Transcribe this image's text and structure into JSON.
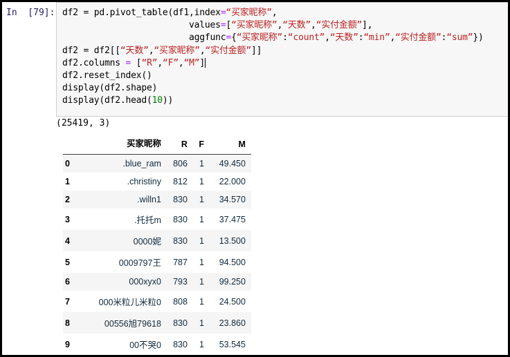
{
  "notebook": {
    "cell": {
      "prompt_label": "In  [79]:",
      "code_lines": [
        [
          {
            "t": "df2 = pd.pivot_table(df1,index",
            "c": "plain"
          },
          {
            "t": "=",
            "c": "op"
          },
          {
            "t": "“买家昵称”",
            "c": "str"
          },
          {
            "t": ",",
            "c": "plain"
          }
        ],
        [
          {
            "t": "                        values",
            "c": "plain"
          },
          {
            "t": "=",
            "c": "op"
          },
          {
            "t": "[",
            "c": "plain"
          },
          {
            "t": "“买家昵称”",
            "c": "str"
          },
          {
            "t": ",",
            "c": "plain"
          },
          {
            "t": "“天数”",
            "c": "str"
          },
          {
            "t": ",",
            "c": "plain"
          },
          {
            "t": "“实付金额”",
            "c": "str"
          },
          {
            "t": "],",
            "c": "plain"
          }
        ],
        [
          {
            "t": "                        aggfunc",
            "c": "plain"
          },
          {
            "t": "=",
            "c": "op"
          },
          {
            "t": "{",
            "c": "plain"
          },
          {
            "t": "“买家昵称”",
            "c": "str"
          },
          {
            "t": ":",
            "c": "plain"
          },
          {
            "t": "“count”",
            "c": "str"
          },
          {
            "t": ",",
            "c": "plain"
          },
          {
            "t": "“天数”",
            "c": "str"
          },
          {
            "t": ":",
            "c": "plain"
          },
          {
            "t": "“min”",
            "c": "str"
          },
          {
            "t": ",",
            "c": "plain"
          },
          {
            "t": "“实付金额”",
            "c": "str"
          },
          {
            "t": ":",
            "c": "plain"
          },
          {
            "t": "“sum”",
            "c": "str"
          },
          {
            "t": "})",
            "c": "plain"
          }
        ],
        [
          {
            "t": "df2 = df2[[",
            "c": "plain"
          },
          {
            "t": "“天数”",
            "c": "str"
          },
          {
            "t": ",",
            "c": "plain"
          },
          {
            "t": "“买家昵称”",
            "c": "str"
          },
          {
            "t": ",",
            "c": "plain"
          },
          {
            "t": "“实付金额”",
            "c": "str"
          },
          {
            "t": "]]",
            "c": "plain"
          }
        ],
        [
          {
            "t": "df2.columns ",
            "c": "plain"
          },
          {
            "t": "=",
            "c": "op"
          },
          {
            "t": " [",
            "c": "plain"
          },
          {
            "t": "“R”",
            "c": "str"
          },
          {
            "t": ",",
            "c": "plain"
          },
          {
            "t": "“F”",
            "c": "str"
          },
          {
            "t": ",",
            "c": "plain"
          },
          {
            "t": "“M”",
            "c": "str"
          },
          {
            "t": "]",
            "c": "plain"
          },
          {
            "t": "",
            "c": "caret"
          }
        ],
        [
          {
            "t": "df2.reset_index()",
            "c": "plain"
          }
        ],
        [
          {
            "t": "display(df2.shape)",
            "c": "plain"
          }
        ],
        [
          {
            "t": "display(df2.head(",
            "c": "plain"
          },
          {
            "t": "10",
            "c": "num"
          },
          {
            "t": "))",
            "c": "plain"
          }
        ]
      ]
    },
    "output_shape": "(25419, 3)",
    "dataframe": {
      "index_header": "",
      "columns": [
        "买家昵称",
        "R",
        "F",
        "M"
      ],
      "rows": [
        {
          "index": "0",
          "name": ".blue_ram",
          "R": "806",
          "F": "1",
          "M": "49.450"
        },
        {
          "index": "1",
          "name": ".christiny",
          "R": "812",
          "F": "1",
          "M": "22.000"
        },
        {
          "index": "2",
          "name": ".willn1",
          "R": "830",
          "F": "1",
          "M": "34.570"
        },
        {
          "index": "3",
          "name": ".托托m",
          "R": "830",
          "F": "1",
          "M": "37.475"
        },
        {
          "index": "4",
          "name": "0000妮",
          "R": "830",
          "F": "1",
          "M": "13.500"
        },
        {
          "index": "5",
          "name": "0009797王",
          "R": "787",
          "F": "1",
          "M": "94.500"
        },
        {
          "index": "6",
          "name": "000xyx0",
          "R": "793",
          "F": "1",
          "M": "99.250"
        },
        {
          "index": "7",
          "name": "000米粒儿米粒0",
          "R": "808",
          "F": "1",
          "M": "24.500"
        },
        {
          "index": "8",
          "name": "00556旭79618",
          "R": "830",
          "F": "1",
          "M": "23.860"
        },
        {
          "index": "9",
          "name": "00不哭0",
          "R": "830",
          "F": "1",
          "M": "53.545"
        }
      ]
    }
  },
  "colors": {
    "string": "#ba2121",
    "operator": "#aa22ff",
    "number": "#008000",
    "prompt": "#202060",
    "cell_background": "#f7f7f7",
    "row_stripe": "#f5f5f5"
  }
}
